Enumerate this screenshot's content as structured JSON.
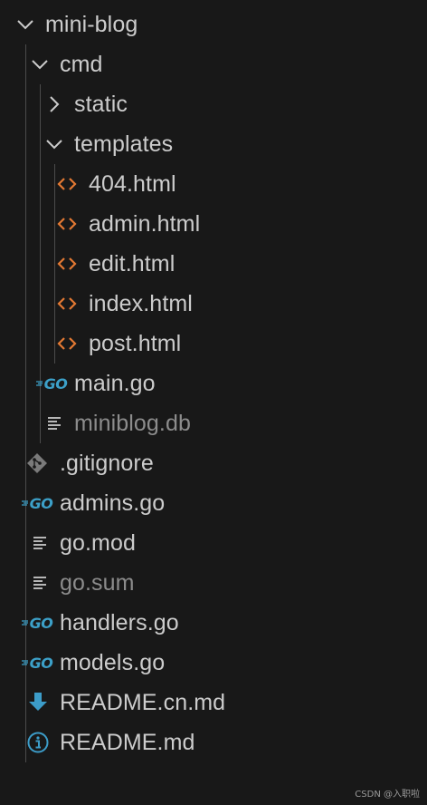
{
  "explorer": {
    "root": {
      "label": "mini-blog"
    },
    "cmd": {
      "label": "cmd"
    },
    "static": {
      "label": "static"
    },
    "templates": {
      "label": "templates"
    },
    "files_templates": [
      {
        "label": "404.html",
        "icon": "html-icon"
      },
      {
        "label": "admin.html",
        "icon": "html-icon"
      },
      {
        "label": "edit.html",
        "icon": "html-icon"
      },
      {
        "label": "index.html",
        "icon": "html-icon"
      },
      {
        "label": "post.html",
        "icon": "html-icon"
      }
    ],
    "cmd_files": [
      {
        "label": "main.go",
        "icon": "go-icon"
      },
      {
        "label": "miniblog.db",
        "icon": "lines-icon",
        "dimmed": true
      }
    ],
    "root_files": [
      {
        "label": ".gitignore",
        "icon": "git-icon"
      },
      {
        "label": "admins.go",
        "icon": "go-icon"
      },
      {
        "label": "go.mod",
        "icon": "lines-icon"
      },
      {
        "label": "go.sum",
        "icon": "lines-icon",
        "dimmed": true
      },
      {
        "label": "handlers.go",
        "icon": "go-icon"
      },
      {
        "label": "models.go",
        "icon": "go-icon"
      },
      {
        "label": "README.cn.md",
        "icon": "download-icon"
      },
      {
        "label": "README.md",
        "icon": "info-icon"
      }
    ],
    "go_icon_text": "GO"
  },
  "colors": {
    "background": "#181818",
    "text": "#cccccc",
    "dimmed_text": "#8c8c8c",
    "html_icon": "#e37933",
    "go_icon": "#3ca0c8",
    "guide": "#4b4b4b"
  },
  "watermark": "CSDN @入职啦"
}
